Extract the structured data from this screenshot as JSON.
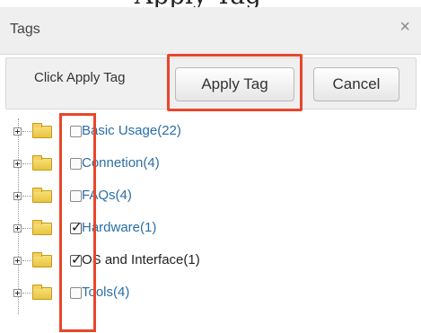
{
  "dialog": {
    "title": "Tags",
    "close_symbol": "×",
    "top_cut_text": "Apply Tag"
  },
  "actions": {
    "instruction": "Click Apply Tag",
    "apply_label": "Apply Tag",
    "cancel_label": "Cancel"
  },
  "tags": [
    {
      "label": "Basic Usage(22)",
      "checked": false
    },
    {
      "label": "Connetion(4)",
      "checked": false
    },
    {
      "label": "FAQs(4)",
      "checked": false
    },
    {
      "label": "Hardware(1)",
      "checked": true
    },
    {
      "label": "OS and Interface(1)",
      "checked": true
    },
    {
      "label": "Tools(4)",
      "checked": false
    }
  ],
  "colors": {
    "highlight": "#e8462a",
    "link": "#2a6ea6",
    "folder": "#e8c440"
  },
  "icons": {
    "close": "close-icon",
    "expander": "expand-plus-icon",
    "folder": "folder-icon",
    "checkbox": "checkbox-icon"
  }
}
